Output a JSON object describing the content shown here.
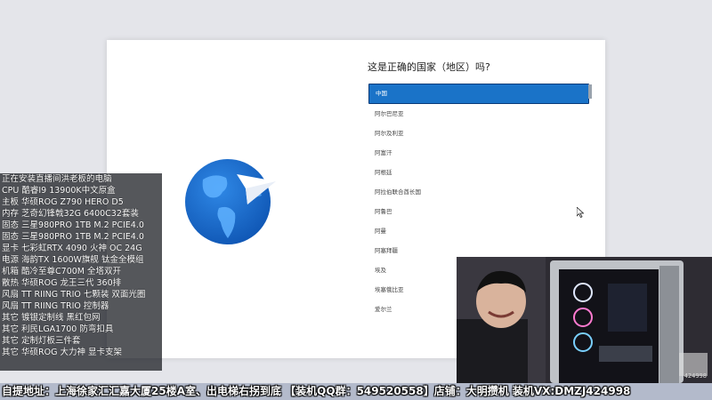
{
  "question": "这是正确的国家（地区）吗?",
  "countries": [
    {
      "label": "中国",
      "selected": true
    },
    {
      "label": "阿尔巴尼亚"
    },
    {
      "label": "阿尔及利亚"
    },
    {
      "label": "阿富汗"
    },
    {
      "label": "阿根廷"
    },
    {
      "label": "阿拉伯联合酋长国"
    },
    {
      "label": "阿鲁巴"
    },
    {
      "label": "阿曼"
    },
    {
      "label": "阿塞拜疆"
    },
    {
      "label": "埃及"
    },
    {
      "label": "埃塞俄比亚"
    },
    {
      "label": "爱尔兰"
    }
  ],
  "overlay_lines": [
    "正在安装直播间洪老板的电脑",
    "CPU 酷睿I9 13900K中文原盒",
    "主板 华硕ROG Z790 HERO D5",
    "内存 芝奇幻锋戟32G 6400C32套装",
    "固态 三星980PRO 1TB M.2 PCIE4.0",
    "固态 三星980PRO 1TB M.2 PCIE4.0",
    "显卡 七彩虹RTX 4090 火神 OC 24G",
    "电源 海韵TX 1600W旗舰 钛金全模组",
    "机箱 酷冷至尊C700M 全塔双开",
    "散热 华硕ROG 龙王三代 360排",
    "风扇 TT RIING TRIO 七颗装 双面光圈",
    "风扇 TT RIING TRIO 控制器",
    "其它 镀银定制线 黑红包网",
    "其它 利民LGA1700 防弯扣具",
    "其它 定制灯板三件套",
    "其它 华硕ROG 大力神 显卡支架"
  ],
  "bottom_text": "自提地址：上海徐家汇汇嘉大厦25楼A室、出电梯右拐到底 【装机QQ群：549520558】店铺：大明攒机  装机VX:DMZJ424998",
  "webcam_badge": "424998",
  "colors": {
    "selected_bg": "#1a73c8",
    "globe": "#1c6fd0"
  }
}
